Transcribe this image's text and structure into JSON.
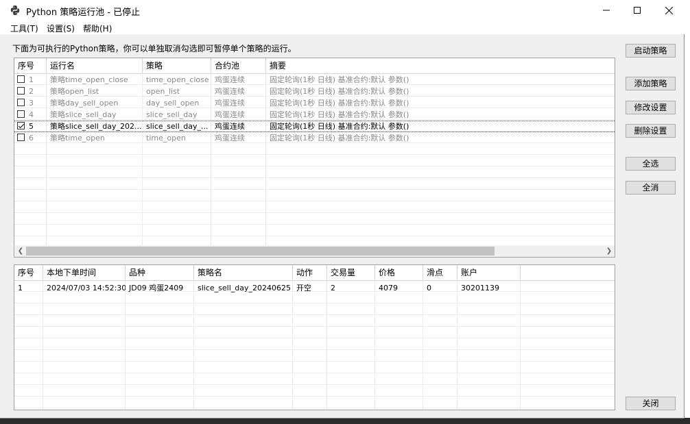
{
  "window": {
    "title": "Python 策略运行池 - 已停止"
  },
  "menu": [
    "工具(T)",
    "设置(S)",
    "帮助(H)"
  ],
  "description": "下面为可执行的Python策略，你可以单独取消勾选即可暂停单个策略的运行。",
  "strategies": {
    "columns": [
      "序号",
      "运行名",
      "策略",
      "合约池",
      "摘要"
    ],
    "rows": [
      {
        "checked": false,
        "idx": "1",
        "name": "策略time_open_close",
        "strategy": "time_open_close",
        "pool": "鸡蛋连续",
        "summary": "固定轮询(1秒 日线) 基准合约:默认 参数()"
      },
      {
        "checked": false,
        "idx": "2",
        "name": "策略open_list",
        "strategy": "open_list",
        "pool": "鸡蛋连续",
        "summary": "固定轮询(1秒 日线) 基准合约:默认 参数()"
      },
      {
        "checked": false,
        "idx": "3",
        "name": "策略day_sell_open",
        "strategy": "day_sell_open",
        "pool": "鸡蛋连续",
        "summary": "固定轮询(1秒 日线) 基准合约:默认 参数()"
      },
      {
        "checked": false,
        "idx": "4",
        "name": "策略slice_sell_day",
        "strategy": "slice_sell_day",
        "pool": "鸡蛋连续",
        "summary": "固定轮询(1秒 日线) 基准合约:默认 参数()"
      },
      {
        "checked": true,
        "idx": "5",
        "name": "策略slice_sell_day_202...",
        "strategy": "slice_sell_day_...",
        "pool": "鸡蛋连续",
        "summary": "固定轮询(1秒 日线) 基准合约:默认 参数()"
      },
      {
        "checked": false,
        "idx": "6",
        "name": "策略time_open",
        "strategy": "time_open",
        "pool": "鸡蛋连续",
        "summary": "固定轮询(1秒 日线) 基准合约:默认 参数()"
      }
    ]
  },
  "orders": {
    "columns": [
      "序号",
      "本地下单时间",
      "品种",
      "策略名",
      "动作",
      "交易量",
      "价格",
      "滑点",
      "账户"
    ],
    "rows": [
      {
        "idx": "1",
        "time": "2024/07/03 14:52:30",
        "product": "JD09 鸡蛋2409",
        "strategy": "slice_sell_day_20240625",
        "action": "开空",
        "volume": "2",
        "price": "4079",
        "slippage": "0",
        "account": "30201139"
      }
    ]
  },
  "buttons": {
    "start": "启动策略",
    "add": "添加策略",
    "modify": "修改设置",
    "delete": "删除设置",
    "select_all": "全选",
    "deselect_all": "全消",
    "close": "关闭"
  },
  "icons": {
    "app": "python-icon",
    "minimize": "minimize-icon",
    "maximize": "maximize-icon",
    "close": "close-icon"
  }
}
